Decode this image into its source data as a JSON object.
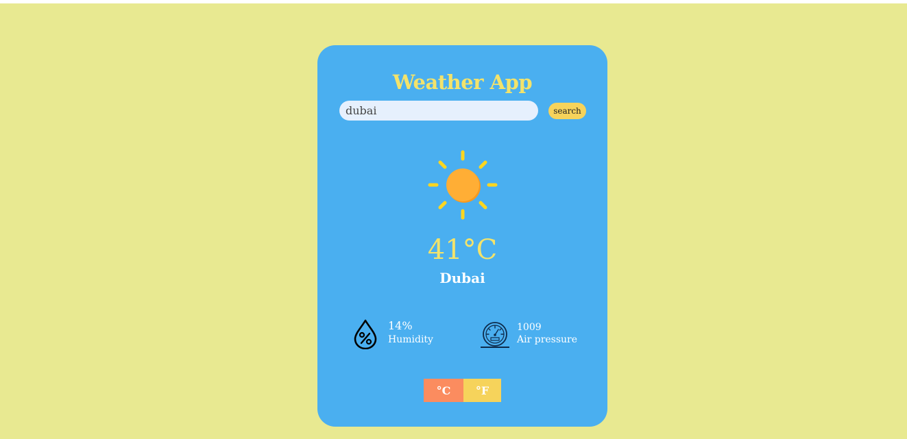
{
  "app": {
    "title": "Weather App"
  },
  "search": {
    "value": "dubai",
    "button_label": "search"
  },
  "weather": {
    "icon": "sun-icon",
    "temperature": "41°C",
    "city": "Dubai"
  },
  "stats": {
    "humidity": {
      "icon": "humidity-drop-icon",
      "value": "14%",
      "label": "Humidity"
    },
    "pressure": {
      "icon": "gauge-icon",
      "value": "1009",
      "label": "Air pressure"
    }
  },
  "units": {
    "celsius_label": "°C",
    "fahrenheit_label": "°F",
    "selected": "°C"
  },
  "colors": {
    "page_background": "#e8e991",
    "card_background": "#4aaff0",
    "accent_yellow": "#f3e36b",
    "button_yellow": "#f6d35b",
    "celsius_orange": "#fb8c5f",
    "sun_core": "#ffae35",
    "sun_rays": "#ffd61f"
  }
}
